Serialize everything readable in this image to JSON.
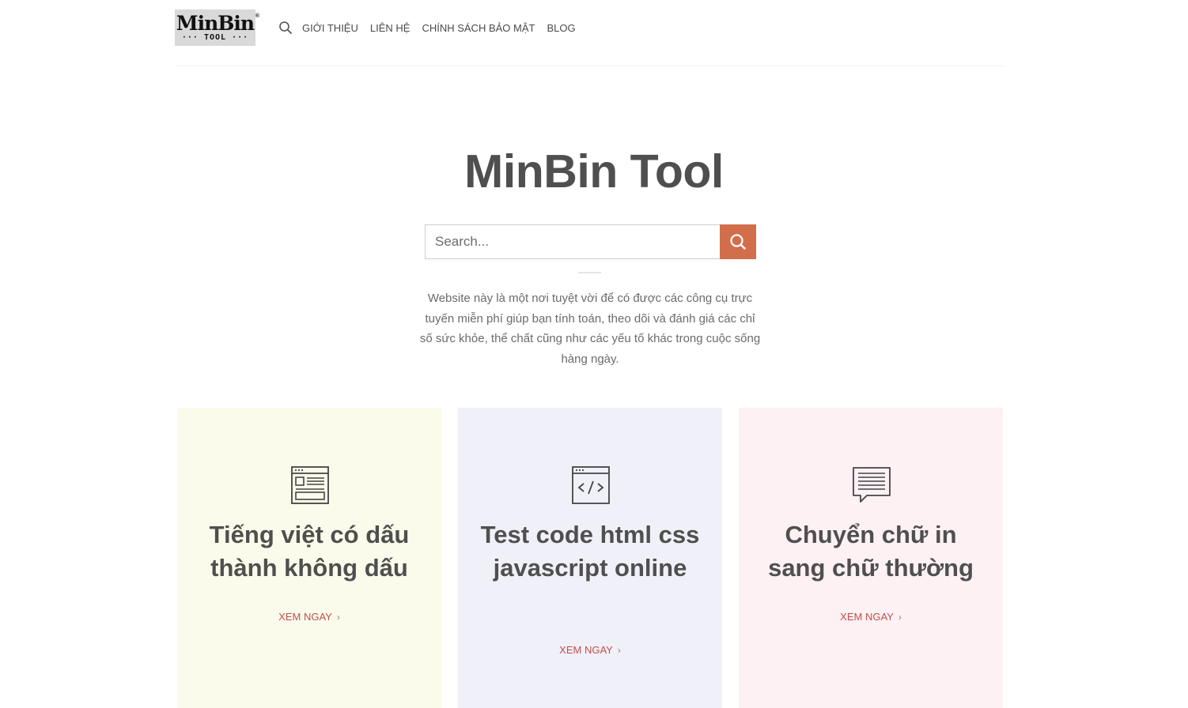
{
  "header": {
    "logo": {
      "main": "MinBin",
      "registered": "®",
      "sub": "··· TOOL ···"
    },
    "nav": [
      {
        "label": "GIỚI THIỆU"
      },
      {
        "label": "LIÊN HỆ"
      },
      {
        "label": "CHÍNH SÁCH BẢO MẬT"
      },
      {
        "label": "BLOG"
      }
    ]
  },
  "hero": {
    "title": "MinBin Tool",
    "search": {
      "placeholder": "Search..."
    },
    "description": "Website này là một nơi tuyệt vời để có được các công cụ trực tuyến miễn phí giúp bạn tính toán, theo dõi và đánh giá các chỉ số sức khỏe, thể chất cũng như các yếu tố khác trong cuộc sống hàng ngày."
  },
  "cards": [
    {
      "title": "Tiếng việt có dấu thành không dấu",
      "link": "XEM NGAY",
      "icon": "layout-window-icon",
      "background": "#fbfbeb"
    },
    {
      "title": "Test code html css javascript online",
      "link": "XEM NGAY",
      "icon": "code-window-icon",
      "background": "#f0f0f8"
    },
    {
      "title": "Chuyển chữ in sang chữ thường",
      "link": "XEM NGAY",
      "icon": "chat-lines-icon",
      "background": "#fdf1f4"
    }
  ],
  "colors": {
    "accent": "#d26e4b",
    "link": "#c0504d",
    "heading": "#4f4f4f"
  }
}
